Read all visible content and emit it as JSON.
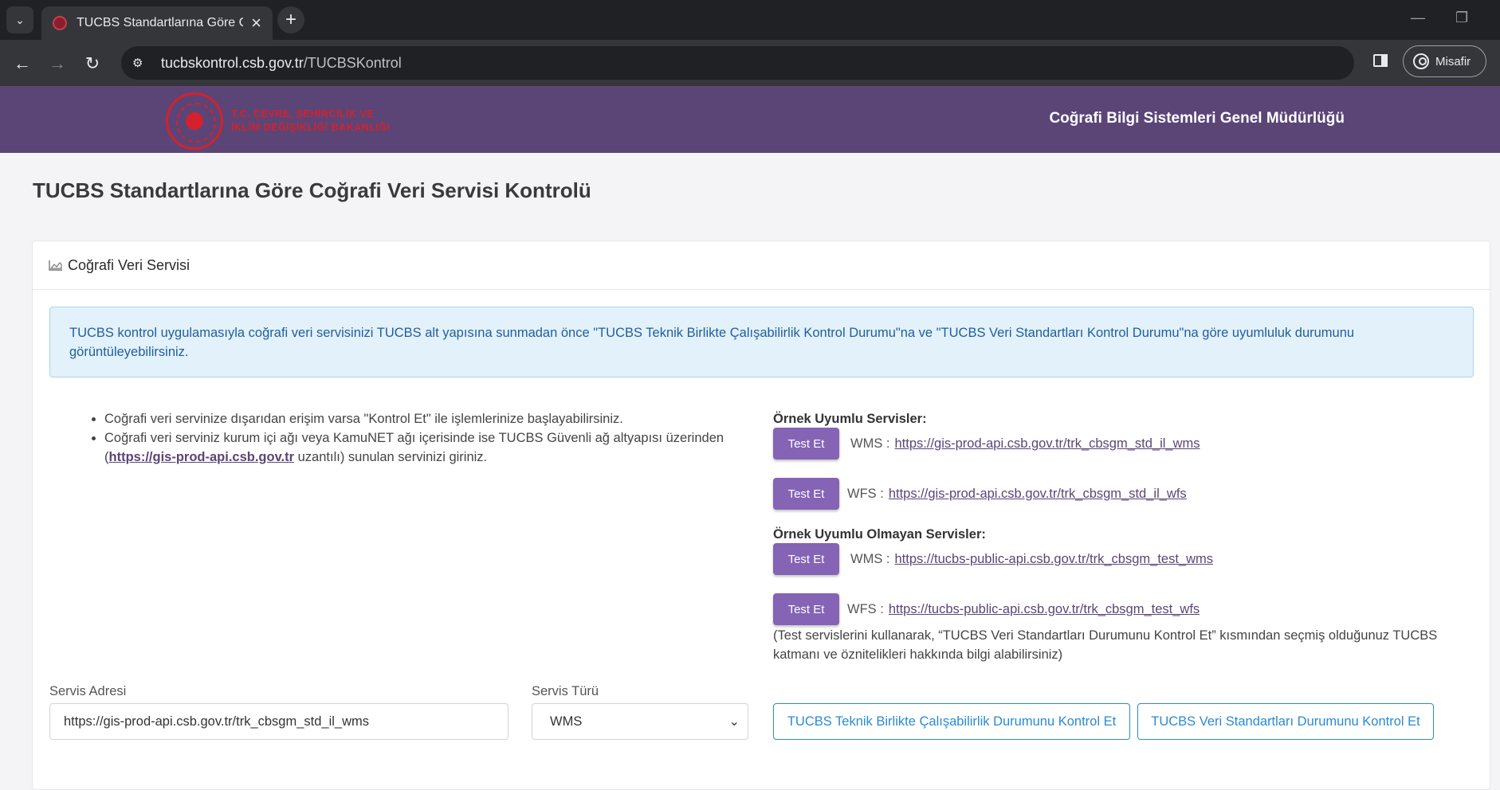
{
  "browser": {
    "tab_title": "TUCBS Standartlarına Göre Coğ",
    "url_host": "tucbskontrol.csb.gov.tr",
    "url_path": "/TUCBSKontrol",
    "profile_label": "Misafir"
  },
  "header": {
    "logo_line1": "T.C. ÇEVRE, ŞEHİRCİLİK VE",
    "logo_line2": "İKLİM DEĞİŞİKLİĞİ BAKANLIĞI",
    "title": "Coğrafi Bilgi Sistemleri Genel Müdürlüğü"
  },
  "page": {
    "title": "TUCBS Standartlarına Göre Coğrafi Veri Servisi Kontrolü"
  },
  "card": {
    "title": "Coğrafi Veri Servisi",
    "alert": "TUCBS kontrol uygulamasıyla coğrafi veri servisinizi TUCBS alt yapısına sunmadan önce \"TUCBS Teknik Birlikte Çalışabilirlik Kontrol Durumu\"na ve \"TUCBS Veri Standartları Kontrol Durumu\"na göre uyumluluk durumunu görüntüleyebilirsiniz.",
    "bullet1": "Coğrafi veri servinize dışarıdan erişim varsa \"Kontrol Et\" ile işlemlerinize başlayabilirsiniz.",
    "bullet2_pre": "Coğrafi veri serviniz kurum içi ağı veya KamuNET ağı içerisinde ise TUCBS Güvenli ağ altyapısı üzerinden (",
    "bullet2_link": "https://gis-prod-api.csb.gov.tr",
    "bullet2_post": " uzantılı) sunulan servinizi giriniz."
  },
  "samples": {
    "compliant_heading": "Örnek Uyumlu Servisler:",
    "noncompliant_heading": "Örnek Uyumlu Olmayan Servisler:",
    "test_label": "Test Et",
    "compliant": [
      {
        "type": "WMS :",
        "url": "https://gis-prod-api.csb.gov.tr/trk_cbsgm_std_il_wms"
      },
      {
        "type": "WFS :",
        "url": "https://gis-prod-api.csb.gov.tr/trk_cbsgm_std_il_wfs"
      }
    ],
    "noncompliant": [
      {
        "type": "WMS :",
        "url": "https://tucbs-public-api.csb.gov.tr/trk_cbsgm_test_wms"
      },
      {
        "type": "WFS :",
        "url": "https://tucbs-public-api.csb.gov.tr/trk_cbsgm_test_wfs"
      }
    ],
    "note": "(Test servislerini kullanarak, “TUCBS Veri Standartları Durumunu Kontrol Et” kısmından seçmiş olduğunuz TUCBS katmanı ve öznitelikleri hakkında bilgi alabilirsiniz)"
  },
  "form": {
    "service_address_label": "Servis Adresi",
    "service_address_value": "https://gis-prod-api.csb.gov.tr/trk_cbsgm_std_il_wms",
    "service_type_label": "Servis Türü",
    "service_type_value": "WMS",
    "btn_interop": "TUCBS Teknik Birlikte Çalışabilirlik Durumunu Kontrol Et",
    "btn_data_std": "TUCBS Veri Standartları Durumunu Kontrol Et"
  },
  "colors": {
    "header_bg": "#5b4577",
    "accent_purple": "#8563b5",
    "outline_blue": "#2a8ad4",
    "alert_bg": "#e3f1fb"
  }
}
